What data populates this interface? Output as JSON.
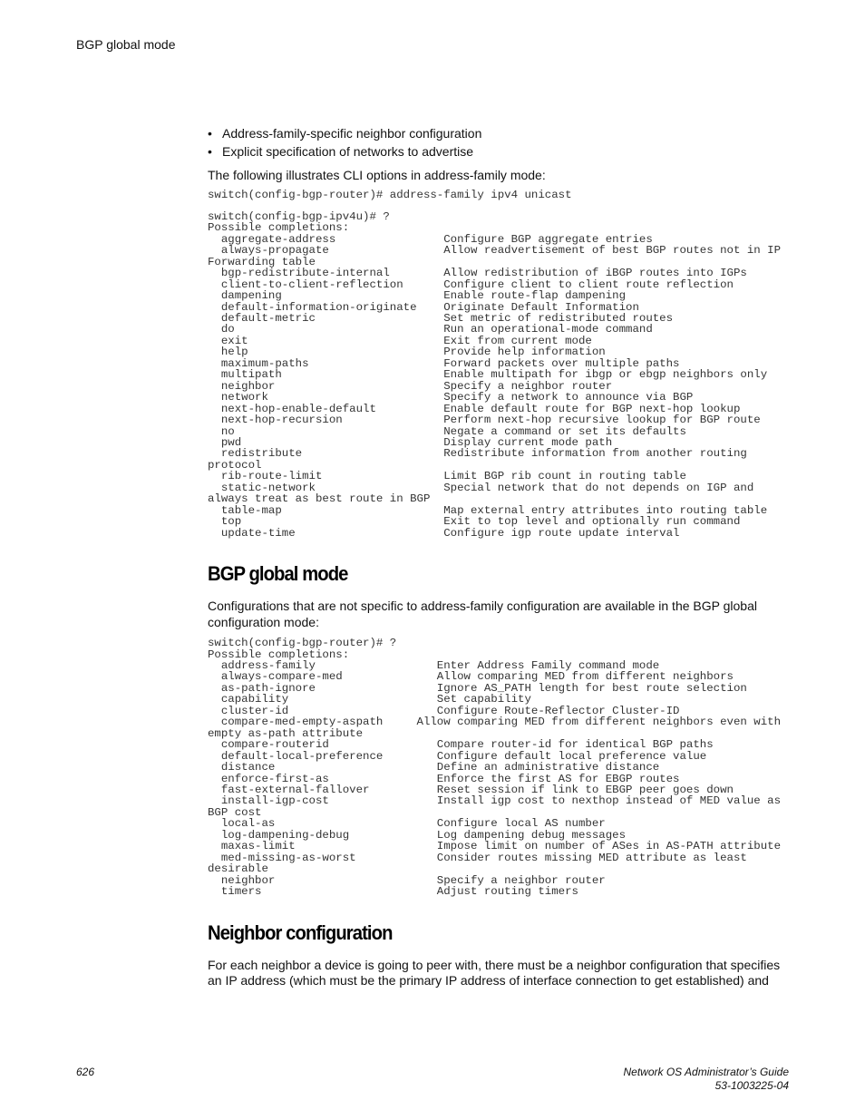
{
  "header": {
    "running_title": "BGP global mode"
  },
  "bullets": [
    "Address-family-specific neighbor configuration",
    "Explicit specification of networks to advertise"
  ],
  "intro_af": "The following illustrates CLI options in address-family mode:",
  "af_command": "switch(config-bgp-router)# address-family ipv4 unicast",
  "af_completions": "switch(config-bgp-ipv4u)# ?\nPossible completions:\n  aggregate-address                Configure BGP aggregate entries\n  always-propagate                 Allow readvertisement of best BGP routes not in IP\nForwarding table\n  bgp-redistribute-internal        Allow redistribution of iBGP routes into IGPs\n  client-to-client-reflection      Configure client to client route reflection\n  dampening                        Enable route-flap dampening\n  default-information-originate    Originate Default Information\n  default-metric                   Set metric of redistributed routes\n  do                               Run an operational-mode command\n  exit                             Exit from current mode\n  help                             Provide help information\n  maximum-paths                    Forward packets over multiple paths\n  multipath                        Enable multipath for ibgp or ebgp neighbors only\n  neighbor                         Specify a neighbor router\n  network                          Specify a network to announce via BGP\n  next-hop-enable-default          Enable default route for BGP next-hop lookup\n  next-hop-recursion               Perform next-hop recursive lookup for BGP route\n  no                               Negate a command or set its defaults\n  pwd                              Display current mode path\n  redistribute                     Redistribute information from another routing\nprotocol\n  rib-route-limit                  Limit BGP rib count in routing table\n  static-network                   Special network that do not depends on IGP and\nalways treat as best route in BGP\n  table-map                        Map external entry attributes into routing table\n  top                              Exit to top level and optionally run command\n  update-time                      Configure igp route update interval",
  "section_global": {
    "title": "BGP global mode",
    "body": "Configurations that are not specific to address-family configuration are available in the BGP global configuration mode:",
    "completions": "switch(config-bgp-router)# ?\nPossible completions:\n  address-family                  Enter Address Family command mode\n  always-compare-med              Allow comparing MED from different neighbors\n  as-path-ignore                  Ignore AS_PATH length for best route selection\n  capability                      Set capability\n  cluster-id                      Configure Route-Reflector Cluster-ID\n  compare-med-empty-aspath     Allow comparing MED from different neighbors even with\nempty as-path attribute\n  compare-routerid                Compare router-id for identical BGP paths\n  default-local-preference        Configure default local preference value\n  distance                        Define an administrative distance\n  enforce-first-as                Enforce the first AS for EBGP routes\n  fast-external-fallover          Reset session if link to EBGP peer goes down\n  install-igp-cost                Install igp cost to nexthop instead of MED value as\nBGP cost\n  local-as                        Configure local AS number\n  log-dampening-debug             Log dampening debug messages\n  maxas-limit                     Impose limit on number of ASes in AS-PATH attribute\n  med-missing-as-worst            Consider routes missing MED attribute as least\ndesirable\n  neighbor                        Specify a neighbor router\n  timers                          Adjust routing timers"
  },
  "section_neighbor": {
    "title": "Neighbor configuration",
    "body": "For each neighbor a device is going to peer with, there must be a neighbor configuration that specifies an IP address (which must be the primary IP address of interface connection to get established) and"
  },
  "footer": {
    "page_number": "626",
    "doc_title": "Network OS Administrator’s Guide",
    "doc_number": "53-1003225-04"
  }
}
